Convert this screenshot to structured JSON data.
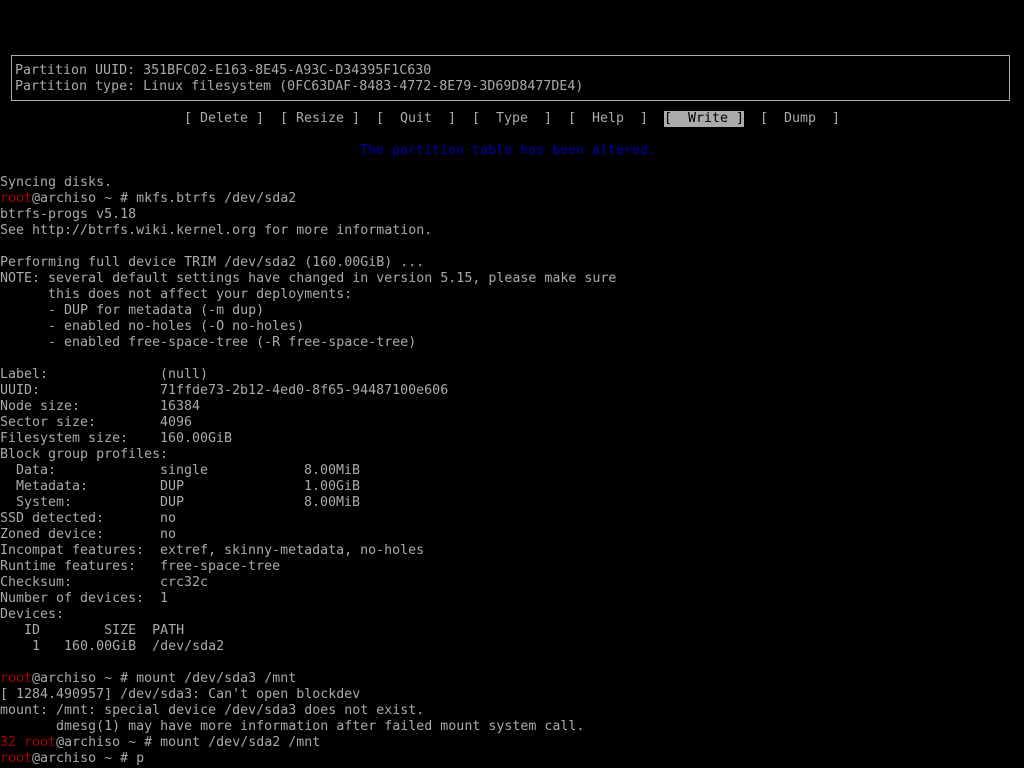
{
  "partition_info": {
    "uuid_line": "Partition UUID: 351BFC02-E163-8E45-A93C-D34395F1C630",
    "type_line": "Partition type: Linux filesystem (0FC63DAF-8483-4772-8E79-3D69D8477DE4)"
  },
  "menu": {
    "items": [
      {
        "label": "[ Delete ]",
        "selected": false
      },
      {
        "label": "[ Resize ]",
        "selected": false
      },
      {
        "label": "[  Quit  ]",
        "selected": false
      },
      {
        "label": "[  Type  ]",
        "selected": false
      },
      {
        "label": "[  Help  ]",
        "selected": false
      },
      {
        "label": "[  Write ]",
        "selected": true
      },
      {
        "label": "[  Dump  ]",
        "selected": false
      }
    ]
  },
  "status_message": "The partition table has been altered.",
  "terminal": {
    "syncing": "Syncing disks.",
    "prompt_user": "root",
    "prompt_rest": "@archiso ~ # ",
    "cmd_mkfs": "mkfs.btrfs /dev/sda2",
    "btrfs_version": "btrfs-progs v5.18",
    "see_info": "See http://btrfs.wiki.kernel.org for more information.",
    "trim": "Performing full device TRIM /dev/sda2 (160.00GiB) ...",
    "note1": "NOTE: several default settings have changed in version 5.15, please make sure",
    "note2": "      this does not affect your deployments:",
    "note3": "      - DUP for metadata (-m dup)",
    "note4": "      - enabled no-holes (-O no-holes)",
    "note5": "      - enabled free-space-tree (-R free-space-tree)",
    "fields": [
      {
        "key": "Label:",
        "value": "(null)"
      },
      {
        "key": "UUID:",
        "value": "71ffde73-2b12-4ed0-8f65-94487100e606"
      },
      {
        "key": "Node size:",
        "value": "16384"
      },
      {
        "key": "Sector size:",
        "value": "4096"
      },
      {
        "key": "Filesystem size:",
        "value": "160.00GiB"
      }
    ],
    "block_group_header": "Block group profiles:",
    "block_groups": [
      {
        "name": "  Data:",
        "profile": "single",
        "size": "8.00MiB"
      },
      {
        "name": "  Metadata:",
        "profile": "DUP",
        "size": "1.00GiB"
      },
      {
        "name": "  System:",
        "profile": "DUP",
        "size": "8.00MiB"
      }
    ],
    "fields2": [
      {
        "key": "SSD detected:",
        "value": "no"
      },
      {
        "key": "Zoned device:",
        "value": "no"
      },
      {
        "key": "Incompat features:",
        "value": "extref, skinny-metadata, no-holes"
      },
      {
        "key": "Runtime features:",
        "value": "free-space-tree"
      },
      {
        "key": "Checksum:",
        "value": "crc32c"
      },
      {
        "key": "Number of devices:",
        "value": "1"
      }
    ],
    "devices_header": "Devices:",
    "devices_columns": "   ID        SIZE  PATH",
    "devices_row": "    1   160.00GiB  /dev/sda2",
    "cmd_mount1": "mount /dev/sda3 /mnt",
    "kernel_msg": "[ 1284.490957] /dev/sda3: Can't open blockdev",
    "mount_err1": "mount: /mnt: special device /dev/sda3 does not exist.",
    "mount_err2": "       dmesg(1) may have more information after failed mount system call.",
    "exit_code": "32 ",
    "cmd_mount2": "mount /dev/sda2 /mnt",
    "cmd_current": "p"
  }
}
